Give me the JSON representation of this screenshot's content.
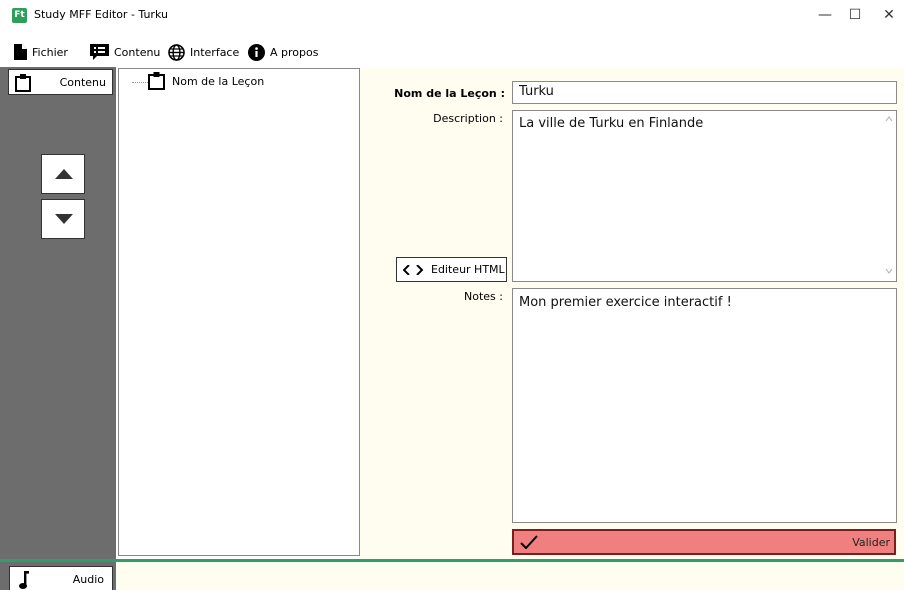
{
  "window": {
    "title": "Study MFF Editor - Turku",
    "app_icon_text": "Ft",
    "minimize_glyph": "—",
    "maximize_glyph": "☐",
    "close_glyph": "✕"
  },
  "menu": [
    {
      "label": "Fichier",
      "icon": "file-icon"
    },
    {
      "label": "Contenu",
      "icon": "list-icon"
    },
    {
      "label": "Interface",
      "icon": "globe-icon"
    },
    {
      "label": "A propos",
      "icon": "info-icon"
    }
  ],
  "sidebar": {
    "tab_label": "Contenu",
    "tab_icon": "clipboard-icon",
    "move_up_icon": "triangle-up-icon",
    "move_down_icon": "triangle-down-icon"
  },
  "tree": {
    "items": [
      {
        "label": "Nom de la Leçon",
        "icon": "clipboard-icon"
      }
    ]
  },
  "form": {
    "name_label": "Nom de la Leçon :",
    "name_value": "Turku",
    "description_label": "Description :",
    "description_value": "La ville de Turku en Finlande",
    "html_editor_label": "Editeur HTML",
    "notes_label": "Notes :",
    "notes_value": "Mon premier exercice interactif !",
    "validate_label": "Valider"
  },
  "bottom": {
    "audio_tab_label": "Audio",
    "audio_tab_icon": "music-note-icon"
  },
  "colors": {
    "panel_gray": "#6d6d6d",
    "form_background": "#fffdf0",
    "validate_red": "#f08080",
    "accent_green": "#2e9e6b"
  }
}
